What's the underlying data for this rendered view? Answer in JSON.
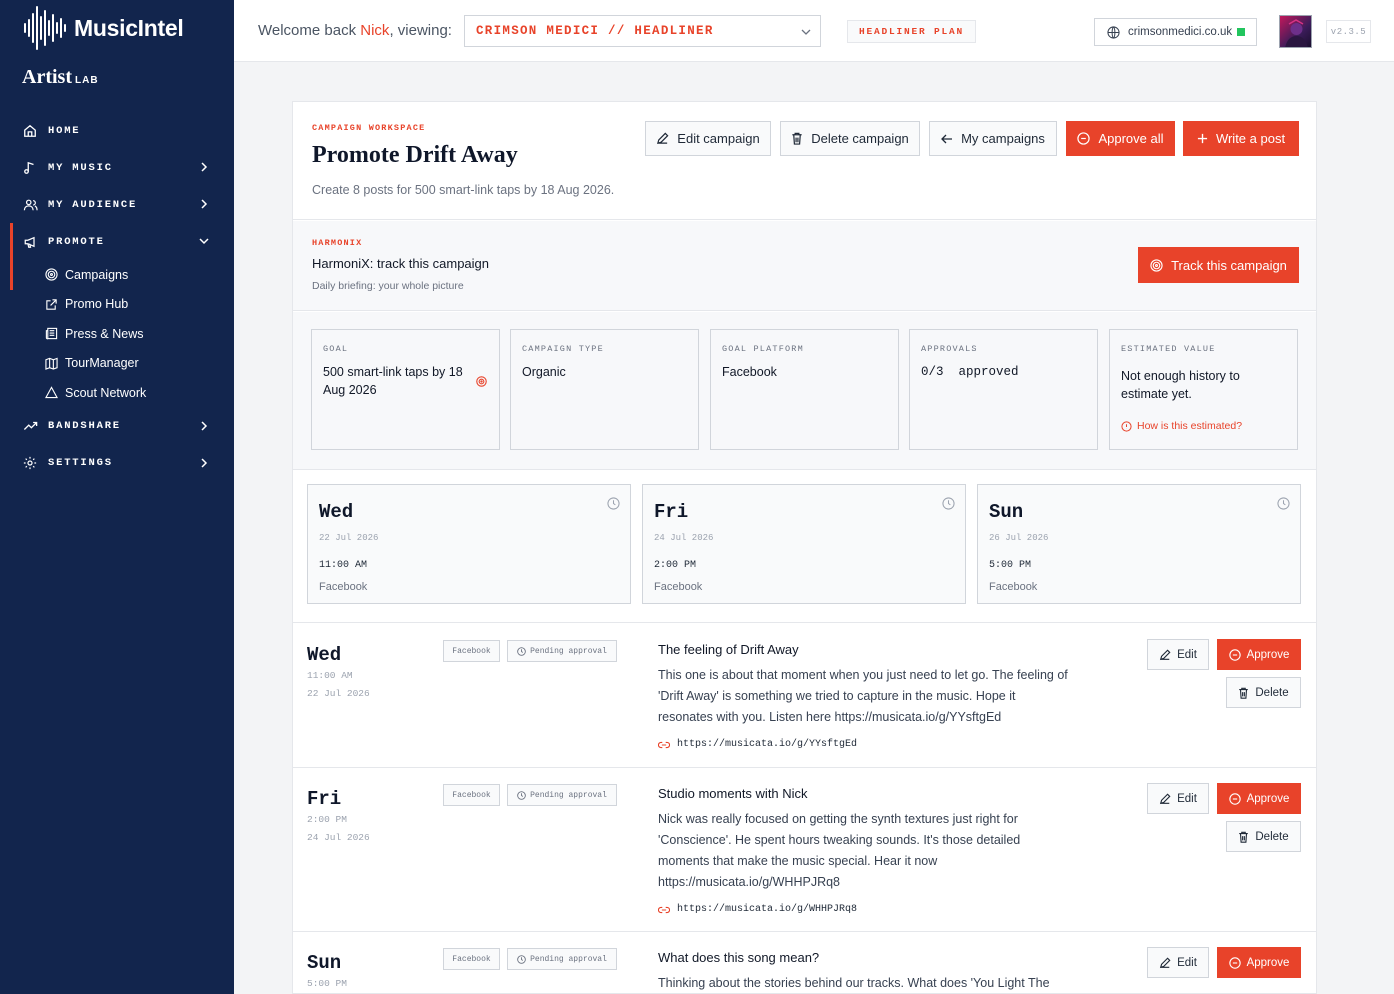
{
  "app": {
    "name": "MusicIntel",
    "product": "Artist",
    "product_suffix": "LAB"
  },
  "nav": {
    "home": "HOME",
    "my_music": "MY MUSIC",
    "my_audience": "MY AUDIENCE",
    "promote": "PROMOTE",
    "promote_items": [
      "Campaigns",
      "Promo Hub",
      "Press & News",
      "TourManager",
      "Scout Network"
    ],
    "bandshare": "BANDSHARE",
    "settings": "SETTINGS"
  },
  "header": {
    "welcome_prefix": "Welcome back ",
    "user": "Nick",
    "welcome_suffix": ", viewing:",
    "artist": "CRIMSON MEDICI // HEADLINER",
    "plan": "HEADLINER PLAN",
    "domain": "crimsonmedici.co.uk",
    "version": "v2.3.5"
  },
  "campaign": {
    "label": "CAMPAIGN WORKSPACE",
    "title": "Promote Drift Away",
    "description": "Create 8 posts for 500 smart-link taps by 18 Aug 2026.",
    "buttons": {
      "edit": "Edit campaign",
      "delete": "Delete campaign",
      "mine": "My campaigns",
      "approve_all": "Approve all",
      "write": "Write a post"
    }
  },
  "harmonix": {
    "label": "HARMONIX",
    "title": "HarmoniX: track this campaign",
    "subtitle": "Daily briefing: your whole picture",
    "button": "Track this campaign"
  },
  "stats": {
    "goal": {
      "key": "GOAL",
      "value": "500 smart-link taps by 18 Aug 2026"
    },
    "type": {
      "key": "CAMPAIGN TYPE",
      "value": "Organic"
    },
    "platform": {
      "key": "GOAL PLATFORM",
      "value": "Facebook"
    },
    "approvals": {
      "key": "APPROVALS",
      "value": "0/3  approved"
    },
    "estimate": {
      "key": "ESTIMATED VALUE",
      "value": "Not enough history to estimate yet.",
      "link": "How is this estimated?"
    }
  },
  "schedule": [
    {
      "day": "Wed",
      "date": "22 Jul 2026",
      "time": "11:00 AM",
      "platform": "Facebook"
    },
    {
      "day": "Fri",
      "date": "24 Jul 2026",
      "time": "2:00 PM",
      "platform": "Facebook"
    },
    {
      "day": "Sun",
      "date": "26 Jul 2026",
      "time": "5:00 PM",
      "platform": "Facebook"
    }
  ],
  "posts": [
    {
      "day": "Wed",
      "time": "11:00 AM",
      "date": "22 Jul 2026",
      "platform": "Facebook",
      "status": "Pending approval",
      "title": "The feeling of Drift Away",
      "body": "This one is about that moment when you just need to let go. The feeling of 'Drift Away' is something we tried to capture in the music. Hope it resonates with you. Listen here https://musicata.io/g/YYsftgEd",
      "link": "https://musicata.io/g/YYsftgEd"
    },
    {
      "day": "Fri",
      "time": "2:00 PM",
      "date": "24 Jul 2026",
      "platform": "Facebook",
      "status": "Pending approval",
      "title": "Studio moments with Nick",
      "body": "Nick was really focused on getting the synth textures just right for 'Conscience'. He spent hours tweaking sounds. It's those detailed moments that make the music special. Hear it now https://musicata.io/g/WHHPJRq8",
      "link": "https://musicata.io/g/WHHPJRq8"
    },
    {
      "day": "Sun",
      "time": "5:00 PM",
      "date": "",
      "platform": "Facebook",
      "status": "Pending approval",
      "title": "What does this song mean?",
      "body": "Thinking about the stories behind our tracks. What does 'You Light The",
      "link": ""
    }
  ],
  "post_buttons": {
    "edit": "Edit",
    "approve": "Approve",
    "delete": "Delete"
  },
  "colors": {
    "sidebar": "#12254d",
    "accent": "#e8432a",
    "status_dot": "#22c55e"
  },
  "icons": [
    "home-icon",
    "music-note-icon",
    "users-icon",
    "megaphone-icon",
    "target-icon",
    "external-link-icon",
    "newspaper-icon",
    "map-icon",
    "triangle-icon",
    "trend-icon",
    "gear-icon",
    "chevron-right-icon",
    "chevron-down-icon",
    "globe-icon",
    "pencil-icon",
    "trash-icon",
    "arrow-left-icon",
    "check-circle-icon",
    "plus-icon",
    "clock-icon",
    "link-icon",
    "info-icon"
  ]
}
